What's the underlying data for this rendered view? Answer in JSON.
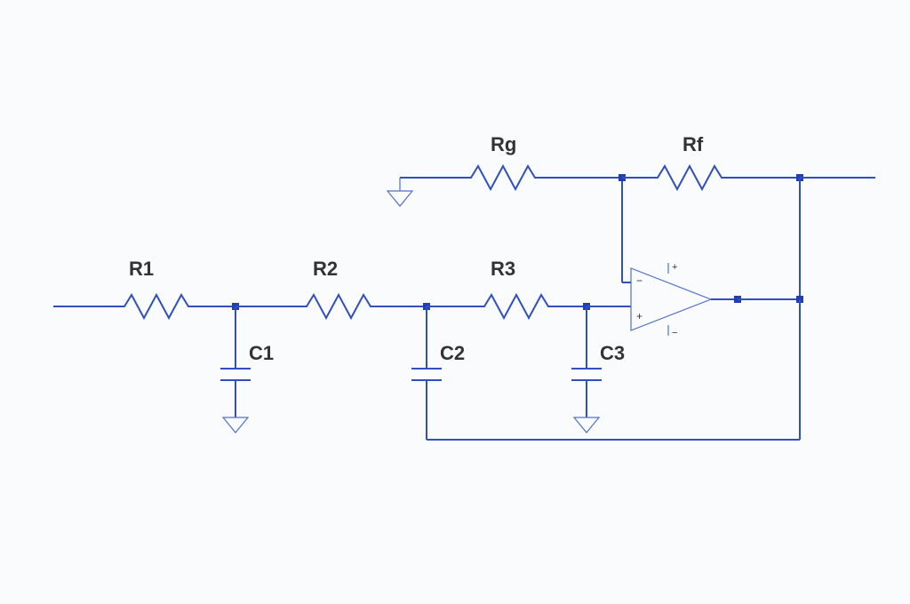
{
  "circuit": {
    "components": {
      "R1": "R1",
      "R2": "R2",
      "R3": "R3",
      "Rg": "Rg",
      "Rf": "Rf",
      "C1": "C1",
      "C2": "C2",
      "C3": "C3"
    },
    "opamp": {
      "minus": "−",
      "plus": "+",
      "vplus": "+",
      "vminus": "−"
    }
  }
}
